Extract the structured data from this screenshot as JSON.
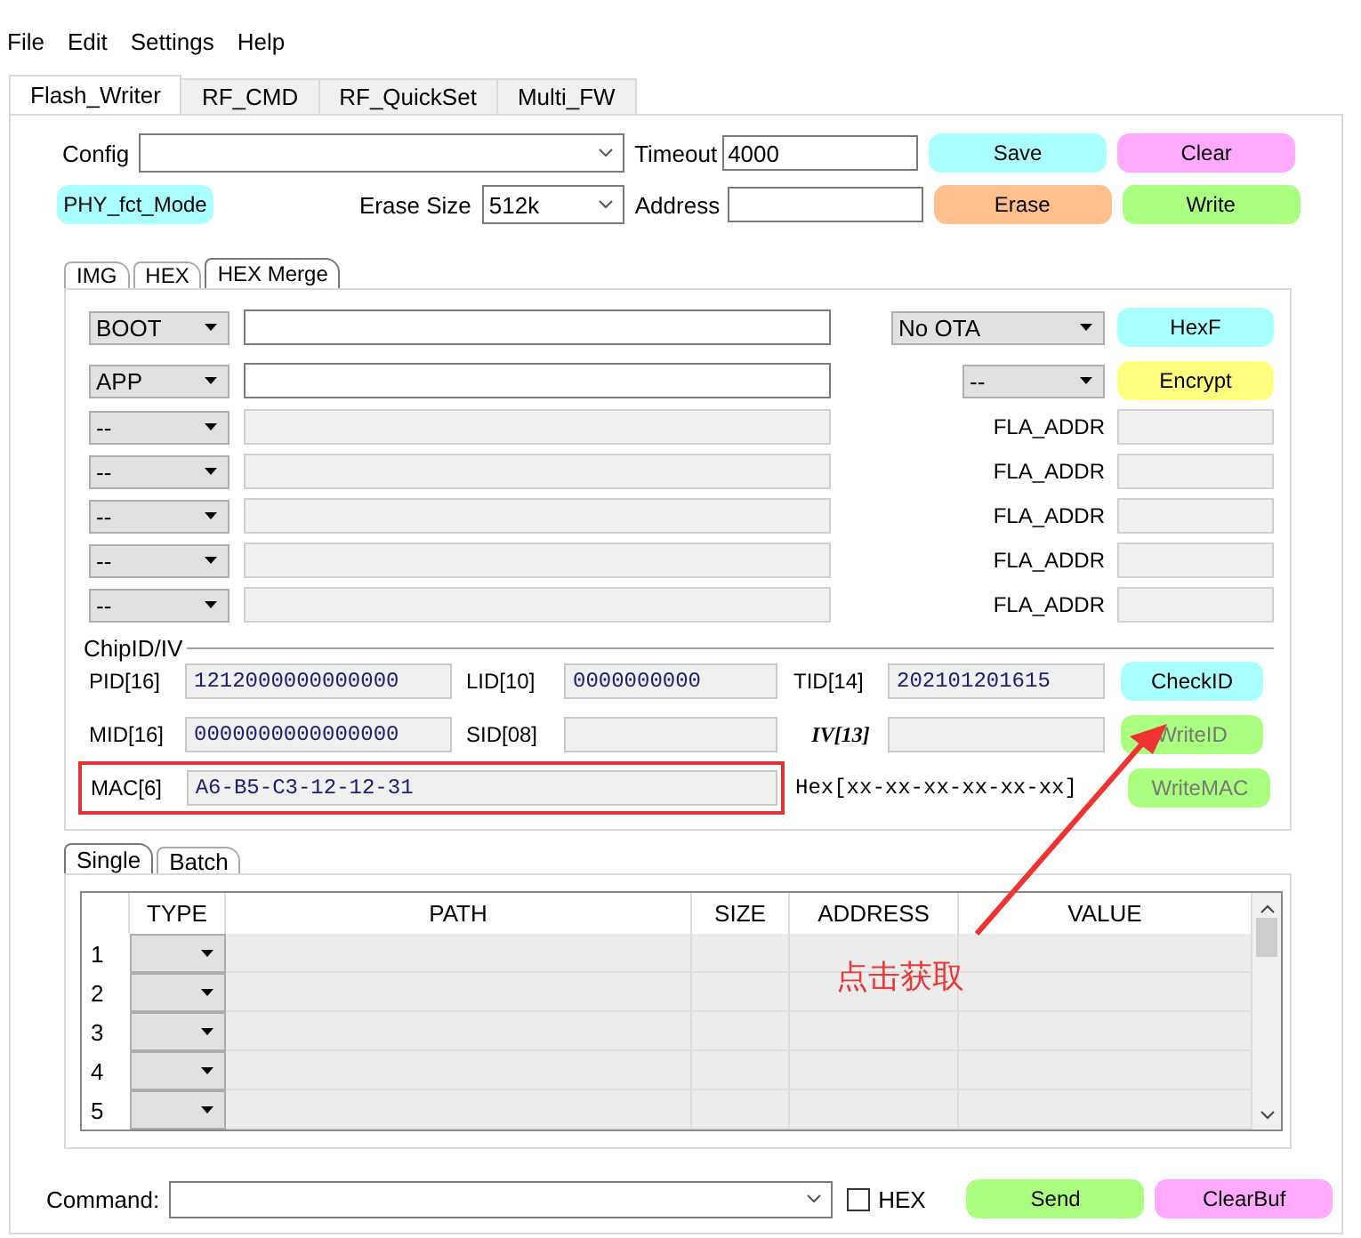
{
  "menu": [
    "File",
    "Edit",
    "Settings",
    "Help"
  ],
  "tabs": [
    {
      "label": "Flash_Writer",
      "selected": true
    },
    {
      "label": "RF_CMD",
      "selected": false
    },
    {
      "label": "RF_QuickSet",
      "selected": false
    },
    {
      "label": "Multi_FW",
      "selected": false
    }
  ],
  "settings": {
    "config_label": "Config",
    "timeout_label": "Timeout",
    "timeout": "4000",
    "mode_button": {
      "label": "PHY_fct_Mode",
      "color": "#aaffff"
    },
    "erase_size_label": "Erase Size",
    "erase_size": "512k",
    "address_label": "Address"
  },
  "actions": [
    {
      "label": "Save",
      "color": "#aaffff"
    },
    {
      "label": "Clear",
      "color": "#ffaaff"
    },
    {
      "label": "Erase",
      "color": "#ffc08e"
    },
    {
      "label": "Write",
      "color": "#aaff80"
    }
  ],
  "file_tabs": [
    {
      "label": "IMG",
      "selected": false
    },
    {
      "label": "HEX",
      "selected": false
    },
    {
      "label": "HEX Merge",
      "selected": true
    }
  ],
  "hex_rows": [
    {
      "kind": "file",
      "type": "BOOT",
      "option": "No OTA",
      "button": {
        "label": "HexF",
        "color": "#aaffff"
      },
      "disabled": false
    },
    {
      "kind": "file",
      "type": "APP",
      "option": "--",
      "button": {
        "label": "Encrypt",
        "color": "#ffff80"
      },
      "disabled": false
    },
    {
      "kind": "addr",
      "type": "--",
      "addr_label": "FLA_ADDR",
      "disabled": true
    },
    {
      "kind": "addr",
      "type": "--",
      "addr_label": "FLA_ADDR",
      "disabled": true
    },
    {
      "kind": "addr",
      "type": "--",
      "addr_label": "FLA_ADDR",
      "disabled": true
    },
    {
      "kind": "addr",
      "type": "--",
      "addr_label": "FLA_ADDR",
      "disabled": true
    },
    {
      "kind": "addr",
      "type": "--",
      "addr_label": "FLA_ADDR",
      "disabled": true
    }
  ],
  "chip": {
    "title": "ChipID/IV",
    "fields": [
      {
        "label": "PID[16]",
        "value": "1212000000000000",
        "emphasis": false
      },
      {
        "label": "LID[10]",
        "value": "0000000000",
        "emphasis": false
      },
      {
        "label": "TID[14]",
        "value": "202101201615",
        "emphasis": false
      },
      {
        "label": "MID[16]",
        "value": "0000000000000000",
        "emphasis": false
      },
      {
        "label": "SID[08]",
        "emphasis": false
      },
      {
        "label": "IV[13]",
        "emphasis": true
      }
    ],
    "mac": {
      "label": "MAC[6]",
      "value": "A6-B5-C3-12-12-31",
      "highlighted": true
    },
    "hint": "Hex[xx-xx-xx-xx-xx-xx]",
    "buttons": [
      {
        "label": "CheckID",
        "color": "#aaffff",
        "disabled": false
      },
      {
        "label": "WriteID",
        "color": "#aaff80",
        "disabled": true
      },
      {
        "label": "WriteMAC",
        "color": "#aaff80",
        "disabled": true
      }
    ]
  },
  "annotation": {
    "text": "点击获取"
  },
  "batch_tabs": [
    {
      "label": "Single",
      "selected": true
    },
    {
      "label": "Batch",
      "selected": false
    }
  ],
  "table": {
    "columns": [
      "TYPE",
      "PATH",
      "SIZE",
      "ADDRESS",
      "VALUE"
    ],
    "rows": [
      "1",
      "2",
      "3",
      "4",
      "5"
    ]
  },
  "command": {
    "label": "Command:",
    "hex_label": "HEX",
    "hex_checked": false,
    "buttons": [
      {
        "label": "Send",
        "color": "#aaff80"
      },
      {
        "label": "ClearBuf",
        "color": "#ffaaff"
      }
    ]
  }
}
